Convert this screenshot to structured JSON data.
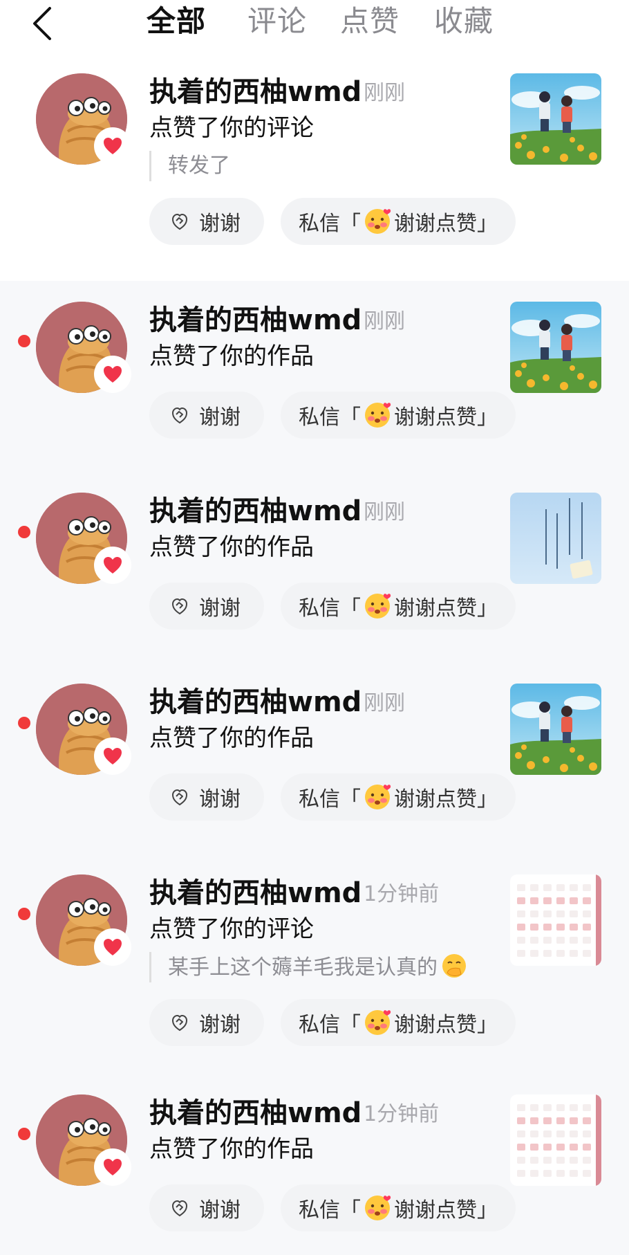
{
  "header": {
    "back_icon": "chevron-left-icon",
    "tabs": [
      {
        "label": "全部",
        "active": true
      },
      {
        "label": "评论",
        "active": false
      },
      {
        "label": "点赞",
        "active": false
      },
      {
        "label": "收藏",
        "active": false
      }
    ]
  },
  "colors": {
    "unread_dot": "#f03a3a",
    "heart": "#f0344a",
    "avatar_bg": "#b8696c",
    "button_bg": "#f2f3f5"
  },
  "notifications": [
    {
      "user": "执着的西柚wmd",
      "time": "刚刚",
      "action": "点赞了你的评论",
      "quote": "转发了",
      "quote_emoji": "",
      "unread": false,
      "thumbnail": "anime-couple-running"
    },
    {
      "user": "执着的西柚wmd",
      "time": "刚刚",
      "action": "点赞了你的作品",
      "quote": "",
      "quote_emoji": "",
      "unread": true,
      "thumbnail": "anime-couple-running"
    },
    {
      "user": "执着的西柚wmd",
      "time": "刚刚",
      "action": "点赞了你的作品",
      "quote": "",
      "quote_emoji": "",
      "unread": true,
      "thumbnail": "blue-poster"
    },
    {
      "user": "执着的西柚wmd",
      "time": "刚刚",
      "action": "点赞了你的作品",
      "quote": "",
      "quote_emoji": "",
      "unread": true,
      "thumbnail": "anime-couple-running"
    },
    {
      "user": "执着的西柚wmd",
      "time": "1分钟前",
      "action": "点赞了你的评论",
      "quote": "某手上这个薅羊毛我是认真的",
      "quote_emoji": "face-with-hand-over-mouth",
      "unread": true,
      "thumbnail": "calendar-grid"
    },
    {
      "user": "执着的西柚wmd",
      "time": "1分钟前",
      "action": "点赞了你的作品",
      "quote": "",
      "quote_emoji": "",
      "unread": true,
      "thumbnail": "calendar-grid"
    }
  ],
  "buttons": {
    "thanks_label": "谢谢",
    "dm_prefix": "私信「",
    "dm_text": "谢谢点赞」",
    "dm_emoji": "flushed-face-with-hearts"
  }
}
